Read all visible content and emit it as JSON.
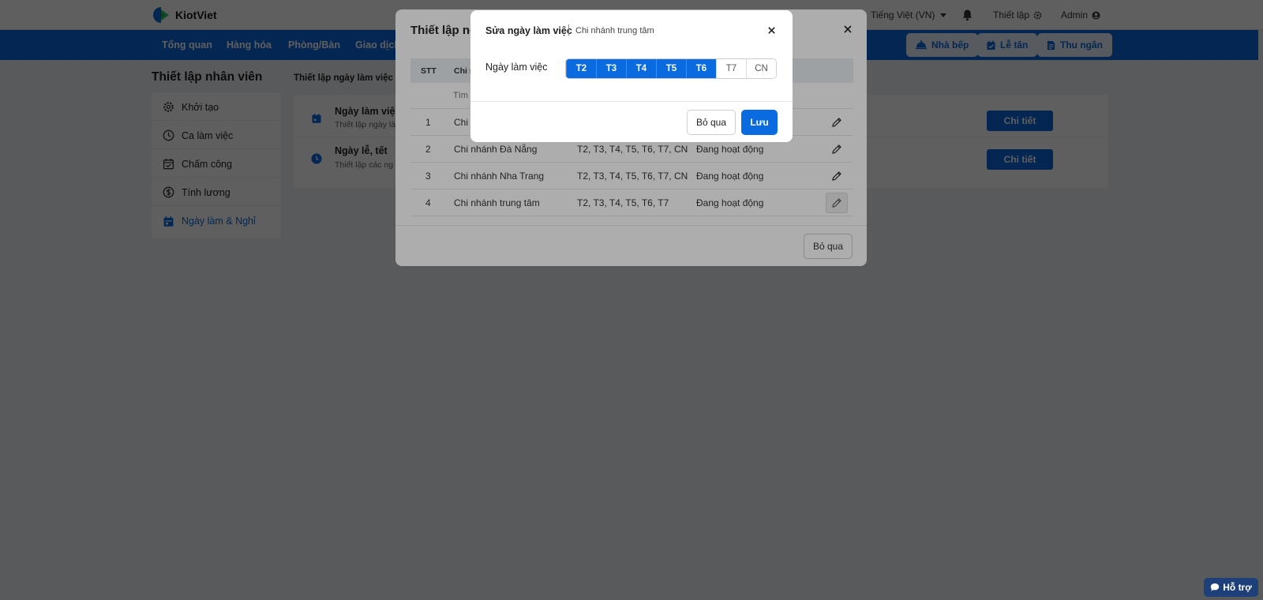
{
  "app": {
    "name": "KiotViet"
  },
  "topbar": {
    "language": "Tiếng Việt (VN)",
    "settings": "Thiết lập",
    "user": "Admin"
  },
  "nav": {
    "items": [
      "Tổng quan",
      "Hàng hóa",
      "Phòng/Bàn",
      "Giao dịch"
    ],
    "buttons": [
      "Nhà bếp",
      "Lễ tân",
      "Thu ngân"
    ]
  },
  "sidebar": {
    "title": "Thiết lập nhân viên",
    "items": [
      {
        "label": "Khởi tạo",
        "icon": "gear-icon"
      },
      {
        "label": "Ca làm việc",
        "icon": "clock-icon"
      },
      {
        "label": "Chấm công",
        "icon": "calendar-check-icon"
      },
      {
        "label": "Tính lương",
        "icon": "dollar-icon"
      },
      {
        "label": "Ngày làm & Nghỉ",
        "icon": "calendar-icon",
        "active": true
      }
    ]
  },
  "main": {
    "title": "Thiết lập ngày làm việc &",
    "rows": [
      {
        "title": "Ngày làm việc",
        "subtitle": "Thiết lập ngày là",
        "button": "Chi tiết"
      },
      {
        "title": "Ngày lễ, tết",
        "subtitle": "Thiết lập các ng",
        "button": "Chi tiết"
      }
    ]
  },
  "modal1": {
    "title": "Thiết lập ng",
    "columns": {
      "stt": "STT",
      "branch": "Chi n"
    },
    "search_placeholder": "Tìm",
    "rows": [
      {
        "stt": "1",
        "branch": "Chi",
        "days": "",
        "status": ""
      },
      {
        "stt": "2",
        "branch": "Chi nhánh Đà Nẵng",
        "days": "T2, T3, T4, T5, T6, T7, CN",
        "status": "Đang hoạt động"
      },
      {
        "stt": "3",
        "branch": "Chi nhánh Nha Trang",
        "days": "T2, T3, T4, T5, T6, T7, CN",
        "status": "Đang hoạt động"
      },
      {
        "stt": "4",
        "branch": "Chi nhánh trung tâm",
        "days": "T2, T3, T4, T5, T6, T7",
        "status": "Đang hoạt động"
      }
    ],
    "skip": "Bỏ qua"
  },
  "modal2": {
    "title": "Sửa ngày làm việc",
    "branch": "Chi nhánh trung tâm",
    "label": "Ngày làm việc",
    "days": [
      {
        "label": "T2",
        "selected": true
      },
      {
        "label": "T3",
        "selected": true
      },
      {
        "label": "T4",
        "selected": true
      },
      {
        "label": "T5",
        "selected": true
      },
      {
        "label": "T6",
        "selected": true
      },
      {
        "label": "T7",
        "selected": false
      },
      {
        "label": "CN",
        "selected": false
      }
    ],
    "skip": "Bỏ qua",
    "save": "Lưu"
  },
  "support": {
    "label": "Hỗ trợ"
  },
  "colors": {
    "primary": "#0a6adf",
    "background": "#f0f2f5",
    "support": "#1d3f7a"
  }
}
